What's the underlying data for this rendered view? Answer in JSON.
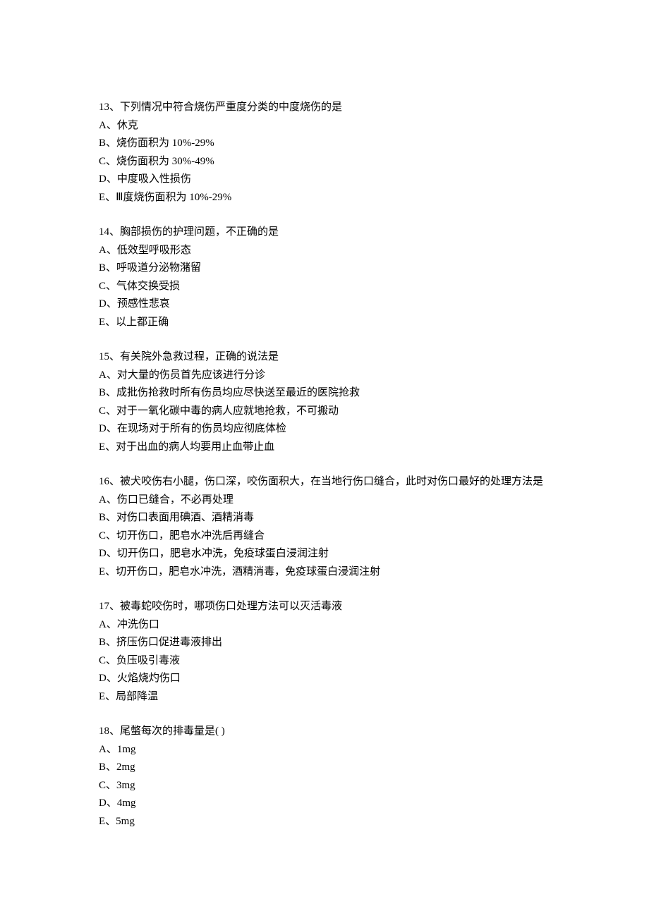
{
  "questions": [
    {
      "number": "13、",
      "text": "下列情况中符合烧伤严重度分类的中度烧伤的是",
      "options": [
        "A、休克",
        "B、烧伤面积为 10%-29%",
        "C、烧伤面积为 30%-49%",
        "D、中度吸入性损伤",
        "E、Ⅲ度烧伤面积为 10%-29%"
      ]
    },
    {
      "number": "14、",
      "text": "胸部损伤的护理问题，不正确的是",
      "options": [
        "A、低效型呼吸形态",
        "B、呼吸道分泌物潴留",
        "C、气体交换受损",
        "D、预感性悲哀",
        "E、以上都正确"
      ]
    },
    {
      "number": "15、",
      "text": "有关院外急救过程，正确的说法是",
      "options": [
        "A、对大量的伤员首先应该进行分诊",
        "B、成批伤抢救时所有伤员均应尽快送至最近的医院抢救",
        "C、对于一氧化碳中毒的病人应就地抢救，不可搬动",
        "D、在现场对于所有的伤员均应彻底体检",
        "E、对于出血的病人均要用止血带止血"
      ]
    },
    {
      "number": "16、",
      "text": "被犬咬伤右小腿，伤口深，咬伤面积大，在当地行伤口缝合，此时对伤口最好的处理方法是",
      "options": [
        "A、伤口已缝合，不必再处理",
        "B、对伤口表面用碘酒、酒精消毒",
        "C、切开伤口，肥皂水冲洗后再缝合",
        "D、切开伤口，肥皂水冲洗，免疫球蛋白浸润注射",
        "E、切开伤口，肥皂水冲洗，酒精消毒，免疫球蛋白浸润注射"
      ]
    },
    {
      "number": "17、",
      "text": "被毒蛇咬伤时，哪项伤口处理方法可以灭活毒液",
      "options": [
        "A、冲洗伤口",
        "B、挤压伤口促进毒液排出",
        "C、负压吸引毒液",
        "D、火焰烧灼伤口",
        "E、局部降温"
      ]
    },
    {
      "number": "18、",
      "text": "尾蟞每次的排毒量是( )",
      "options": [
        "A、1mg",
        "B、2mg",
        "C、3mg",
        "D、4mg",
        "E、5mg"
      ]
    }
  ]
}
